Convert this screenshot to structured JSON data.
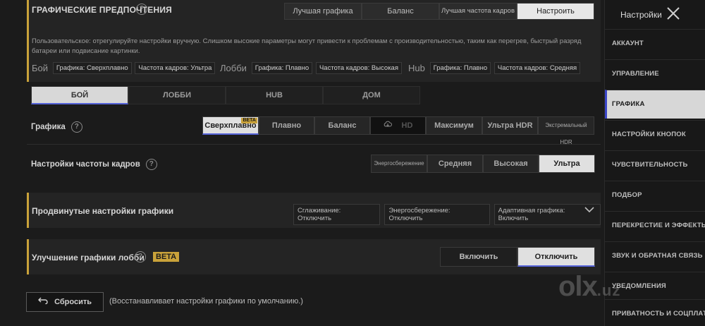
{
  "prefs": {
    "title": "ГРАФИЧЕСКИЕ ПРЕДПОЧТЕНИЯ",
    "options": [
      "Лучшая графика",
      "Баланс",
      "Лучшая частота кадров",
      "Настроить"
    ],
    "selected": "Настроить",
    "description": "Пользовательское: отрегулируйте настройки вручную. Слишком высокие параметры могут привести к проблемам с производительностью, таким как перегрев, быстрый разряд батареи или подвисание картинки.",
    "summary": [
      {
        "label": "Бой",
        "graphics": "Графика: Сверхплавно",
        "fps": "Частота кадров: Ультра"
      },
      {
        "label": "Лобби",
        "graphics": "Графика: Плавно",
        "fps": "Частота кадров: Высокая"
      },
      {
        "label": "Hub",
        "graphics": "Графика: Плавно",
        "fps": "Частота кадров: Средняя"
      }
    ]
  },
  "modes": {
    "items": [
      "БОЙ",
      "ЛОББИ",
      "HUB",
      "ДОМ"
    ],
    "selected": "БОЙ"
  },
  "graphics": {
    "label": "Графика",
    "options": [
      "Сверхплавно",
      "Плавно",
      "Баланс",
      "HD",
      "Максимум",
      "Ультра HDR",
      "Экстремальный HDR"
    ],
    "selected": "Сверхплавно",
    "beta_badge": "BETA",
    "disabled": "HD"
  },
  "fps": {
    "label": "Настройки частоты кадров",
    "options": [
      "Энергосбережение",
      "Средняя",
      "Высокая",
      "Ультра"
    ],
    "selected": "Ультра"
  },
  "advanced": {
    "title": "Продвинутые настройки графики",
    "tags": [
      "Сглаживание: Отключить",
      "Энергосбережение: Отключить",
      "Адаптивная графика: Включить"
    ]
  },
  "lobby_enhance": {
    "title": "Улучшение графики лобби",
    "beta": "BETA",
    "options": [
      "Включить",
      "Отключить"
    ],
    "selected": "Отключить"
  },
  "reset": {
    "label": "Сбросить",
    "note": "(Восстанавливает настройки графики по умолчанию.)"
  },
  "sidebar": {
    "title": "Настройки",
    "items": [
      "Аккаунт",
      "Управление",
      "Графика",
      "Настройки кнопок",
      "Чувствительность",
      "Подбор",
      "Перекрестие и эффекты",
      "Звук и обратная связь",
      "Уведомления",
      "Приватность и соцплатформы"
    ],
    "selected": "Графика"
  },
  "watermark": {
    "main": "olx",
    "tld": ".uz"
  },
  "colors": {
    "accent_gold": "#c9a23a",
    "accent_blue": "#5563d8",
    "sidebar_active": "#d7d7d7"
  },
  "icons": {
    "help": "question-circle-icon",
    "close": "close-icon",
    "expand": "chevron-down-icon",
    "reset": "undo-arrow-icon",
    "cloud": "cloud-download-icon"
  }
}
